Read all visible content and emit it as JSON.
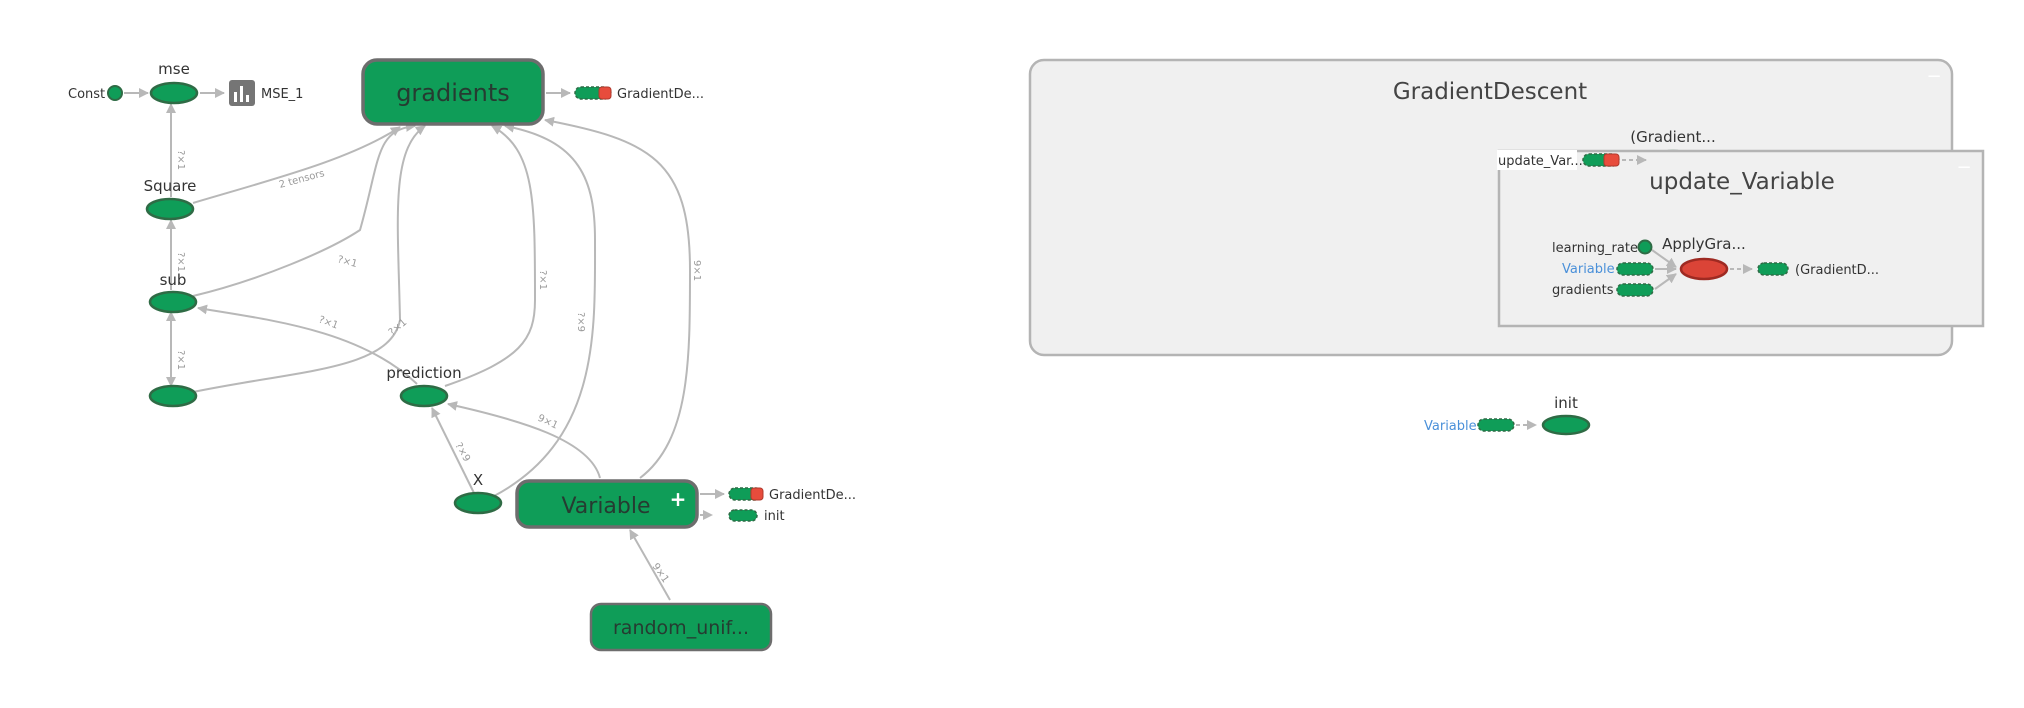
{
  "left_graph": {
    "nodes": {
      "const": "Const",
      "mse": "mse",
      "mse_1": "MSE_1",
      "gradients": "gradients",
      "gradient_descent_ref": "GradientDe...",
      "square": "Square",
      "sub": "sub",
      "prediction": "prediction",
      "x": "X",
      "variable": "Variable",
      "variable_plus": "+",
      "variable_gd_ref": "GradientDe...",
      "variable_init_ref": "init",
      "random_uniform": "random_unif..."
    },
    "edges": {
      "square_to_mse": "?×1",
      "square_to_gradients": "2 tensors",
      "sub_to_square": "?×1",
      "sub_to_gradients": "?×1",
      "sub_to_placeholder": "?×1",
      "prediction_to_sub": "?×1",
      "prediction_to_sub_2": "?×1",
      "prediction_to_gradients": "?×1",
      "x_to_gradients": "?×9",
      "variable_to_gradients": "9×1",
      "variable_to_prediction": "9×1",
      "x_to_prediction": "?×9",
      "random_to_variable": "9×1"
    }
  },
  "gradient_descent": {
    "title": "GradientDescent",
    "collapse": "−",
    "gradient_ref": "(Gradient...",
    "update_var_ref": "update_Var...",
    "update_variable": {
      "title": "update_Variable",
      "collapse": "−",
      "learning_rate": "learning_rate",
      "apply_gradient": "ApplyGra...",
      "variable": "Variable",
      "gradients": "gradients",
      "gradient_d_ref": "(GradientD..."
    }
  },
  "init_group": {
    "variable": "Variable",
    "init": "init"
  },
  "colors": {
    "node_fill": "#0f9d58",
    "node_stroke": "#2f6b45",
    "group_fill": "#0f9d58",
    "group_stroke": "#6d6d6d",
    "namespace_fill": "#f0f0f0",
    "namespace_stroke": "#b4b4b4",
    "edge": "#b8b8b8",
    "control_edge": "#b8b8b8",
    "apply_fill": "#db4437",
    "link_text": "#4a90d9",
    "red_series": "#e74c3c"
  }
}
